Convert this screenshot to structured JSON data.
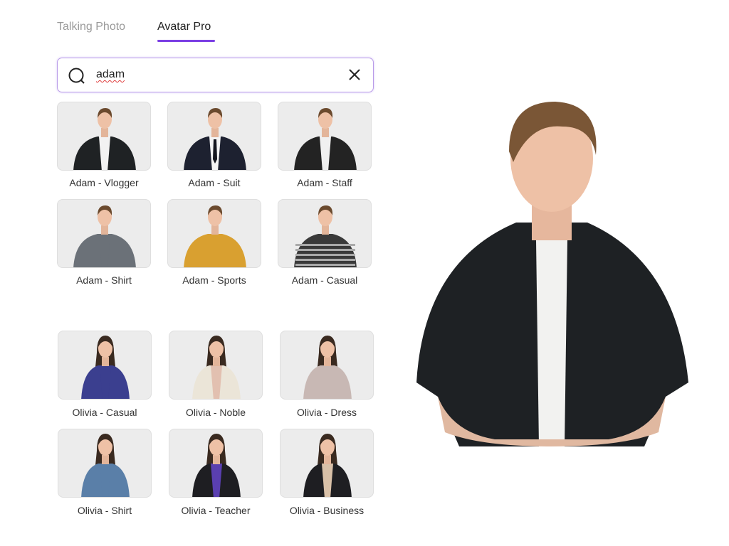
{
  "tabs": [
    {
      "label": "Talking Photo",
      "active": false
    },
    {
      "label": "Avatar Pro",
      "active": true
    }
  ],
  "accent": "#7b3fe4",
  "search": {
    "value": "adam",
    "icon": "search-icon",
    "clear_icon": "close-icon"
  },
  "avatars": [
    {
      "label": "Adam - Vlogger",
      "top": "#1f2224",
      "inner": "#f2f2f2",
      "hair": "#6b4a2e",
      "female": false
    },
    {
      "label": "Adam - Suit",
      "top": "#1d2130",
      "inner": "#f4f4f4",
      "tie": true,
      "hair": "#6b4a2e",
      "female": false
    },
    {
      "label": "Adam - Staff",
      "top": "#232323",
      "inner": "#f0f0f0",
      "hair": "#6b4a2e",
      "female": false
    },
    {
      "label": "Adam - Shirt",
      "top": "#6b7178",
      "inner": "#6b7178",
      "hair": "#6b4a2e",
      "female": false
    },
    {
      "label": "Adam - Sports",
      "top": "#d9a030",
      "inner": "#d9a030",
      "hair": "#6b4a2e",
      "female": false
    },
    {
      "label": "Adam - Casual",
      "top": "#3a3a3a",
      "inner": "#3a3a3a",
      "stripes": true,
      "hair": "#6b4a2e",
      "female": false
    },
    {
      "label": "Olivia - Casual",
      "top": "#3b3f8f",
      "inner": "#3b3f8f",
      "hair": "#3a2a20",
      "female": true
    },
    {
      "label": "Olivia - Noble",
      "top": "#ebe5d8",
      "inner": "#e2c0b0",
      "hair": "#3a2a20",
      "female": true
    },
    {
      "label": "Olivia - Dress",
      "top": "#c8b8b4",
      "inner": "#c8b8b4",
      "hair": "#3a2a20",
      "female": true
    },
    {
      "label": "Olivia - Shirt",
      "top": "#5a7fa8",
      "inner": "#5a7fa8",
      "hair": "#3a2a20",
      "female": true
    },
    {
      "label": "Olivia - Teacher",
      "top": "#1e1e22",
      "inner": "#5a3fb0",
      "hair": "#3a2a20",
      "female": true
    },
    {
      "label": "Olivia - Business",
      "top": "#1e1e22",
      "inner": "#d8c0a8",
      "hair": "#3a2a20",
      "female": true
    }
  ],
  "preview": {
    "name": "Adam - Vlogger"
  }
}
